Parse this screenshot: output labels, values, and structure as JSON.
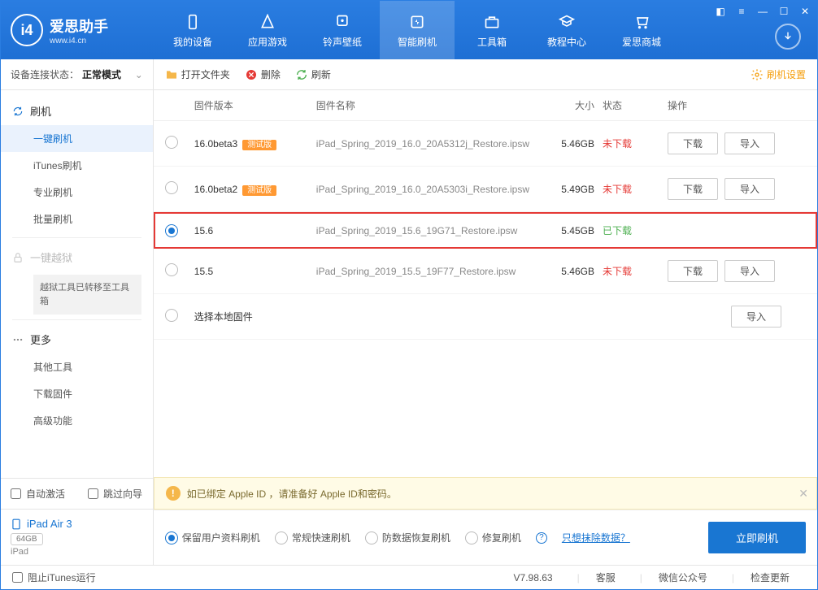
{
  "header": {
    "logo_title": "爱思助手",
    "logo_sub": "www.i4.cn",
    "nav": [
      {
        "label": "我的设备"
      },
      {
        "label": "应用游戏"
      },
      {
        "label": "铃声壁纸"
      },
      {
        "label": "智能刷机"
      },
      {
        "label": "工具箱"
      },
      {
        "label": "教程中心"
      },
      {
        "label": "爱思商城"
      }
    ]
  },
  "sidebar": {
    "status_label": "设备连接状态：",
    "status_value": "正常模式",
    "flash_head": "刷机",
    "flash_items": [
      "一键刷机",
      "iTunes刷机",
      "专业刷机",
      "批量刷机"
    ],
    "jailbreak_head": "一键越狱",
    "jailbreak_note": "越狱工具已转移至工具箱",
    "more_head": "更多",
    "more_items": [
      "其他工具",
      "下载固件",
      "高级功能"
    ],
    "auto_activate": "自动激活",
    "skip_guide": "跳过向导",
    "device_name": "iPad Air 3",
    "device_storage": "64GB",
    "device_type": "iPad"
  },
  "toolbar": {
    "open_folder": "打开文件夹",
    "delete": "删除",
    "refresh": "刷新",
    "settings": "刷机设置"
  },
  "table": {
    "headers": {
      "ver": "固件版本",
      "name": "固件名称",
      "size": "大小",
      "status": "状态",
      "ops": "操作"
    },
    "rows": [
      {
        "ver": "16.0beta3",
        "beta": "测试版",
        "name": "iPad_Spring_2019_16.0_20A5312j_Restore.ipsw",
        "size": "5.46GB",
        "status": "未下载",
        "downloaded": false,
        "selected": false
      },
      {
        "ver": "16.0beta2",
        "beta": "测试版",
        "name": "iPad_Spring_2019_16.0_20A5303i_Restore.ipsw",
        "size": "5.49GB",
        "status": "未下载",
        "downloaded": false,
        "selected": false
      },
      {
        "ver": "15.6",
        "beta": "",
        "name": "iPad_Spring_2019_15.6_19G71_Restore.ipsw",
        "size": "5.45GB",
        "status": "已下载",
        "downloaded": true,
        "selected": true
      },
      {
        "ver": "15.5",
        "beta": "",
        "name": "iPad_Spring_2019_15.5_19F77_Restore.ipsw",
        "size": "5.46GB",
        "status": "未下载",
        "downloaded": false,
        "selected": false
      }
    ],
    "local_row": "选择本地固件",
    "btn_download": "下载",
    "btn_import": "导入"
  },
  "alert": {
    "text": "如已绑定 Apple ID ，请准备好 Apple ID和密码。"
  },
  "options": {
    "keep_data": "保留用户资料刷机",
    "normal": "常规快速刷机",
    "antirecovery": "防数据恢复刷机",
    "repair": "修复刷机",
    "erase_link": "只想抹除数据？",
    "flash_btn": "立即刷机"
  },
  "footer": {
    "block_itunes": "阻止iTunes运行",
    "version": "V7.98.63",
    "service": "客服",
    "wechat": "微信公众号",
    "update": "检查更新"
  }
}
